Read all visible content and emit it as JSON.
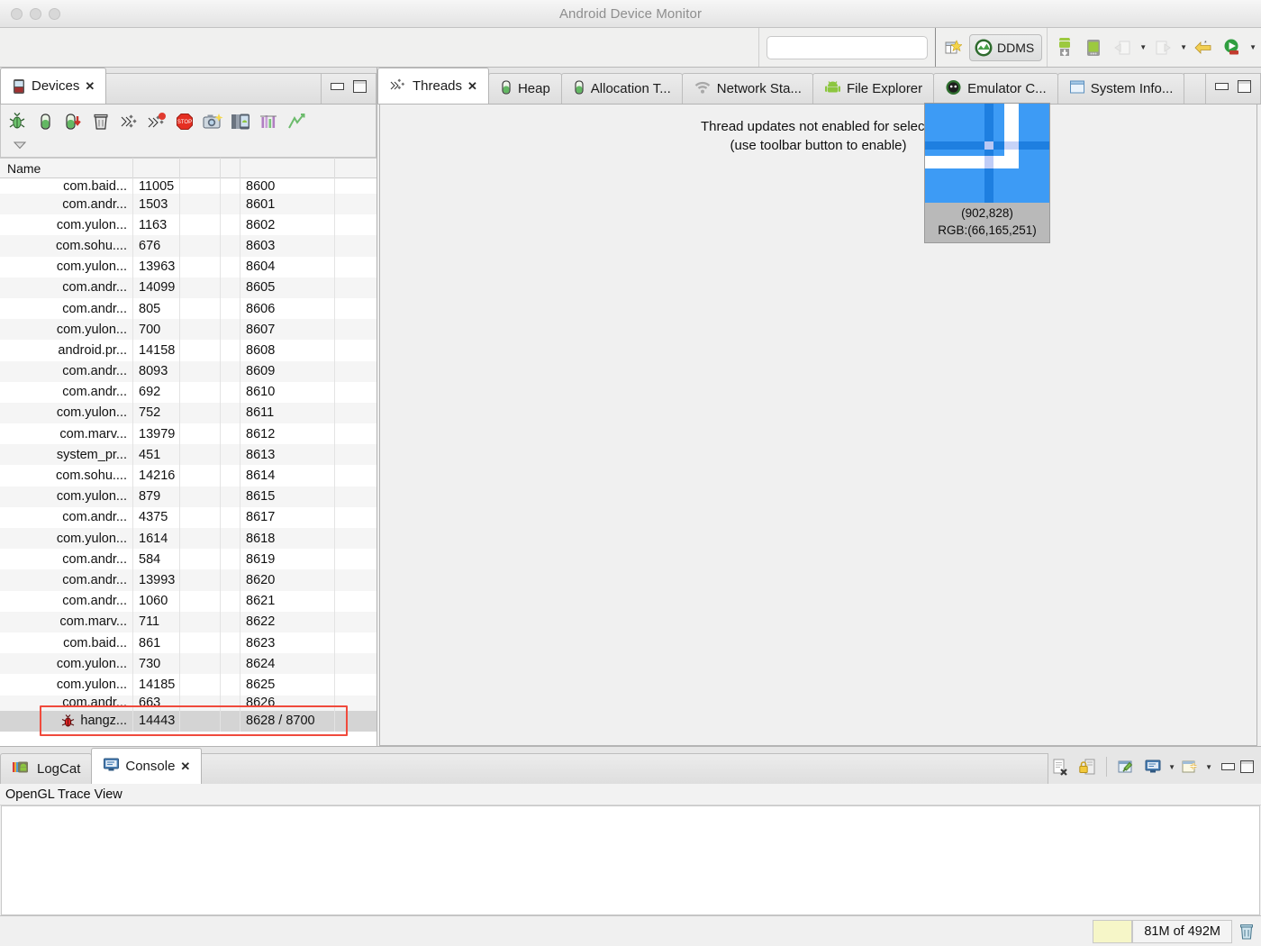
{
  "window": {
    "title": "Android Device Monitor",
    "traffic_lights": [
      "close",
      "minimize",
      "zoom"
    ]
  },
  "toolbar": {
    "search_value": "",
    "search_placeholder": "",
    "buttons": [
      {
        "name": "new-perspective-icon",
        "label": ""
      },
      {
        "name": "ddms-perspective-button",
        "label": "DDMS"
      },
      {
        "name": "device-download-icon",
        "label": ""
      },
      {
        "name": "device-screen-icon",
        "label": ""
      },
      {
        "name": "import-arrow-icon",
        "label": ""
      },
      {
        "name": "export-arrow-icon",
        "label": ""
      },
      {
        "name": "back-arrow-icon",
        "label": ""
      },
      {
        "name": "run-icon",
        "label": ""
      }
    ],
    "ddms_label": "DDMS"
  },
  "devices_panel": {
    "tab_label": "Devices",
    "tab_close": "✕",
    "toolbar_icons": [
      "debug-bug-icon",
      "heap-update-icon",
      "heap-dump-icon",
      "cause-gc-icon",
      "thread-update-icon",
      "thread-update-stop-icon",
      "stop-process-icon",
      "screen-capture-icon",
      "device-frame-icon",
      "systrace-icon",
      "method-profiling-icon",
      "overflow-menu-icon"
    ],
    "columns": [
      "Name",
      "",
      "",
      "",
      "",
      ""
    ],
    "rows": [
      {
        "name": "com.baid...",
        "pid": "11005",
        "port": "8600",
        "partial": true,
        "selected": false
      },
      {
        "name": "com.andr...",
        "pid": "1503",
        "port": "8601",
        "partial": false,
        "selected": false
      },
      {
        "name": "com.yulon...",
        "pid": "1163",
        "port": "8602",
        "partial": false,
        "selected": false
      },
      {
        "name": "com.sohu....",
        "pid": "676",
        "port": "8603",
        "partial": false,
        "selected": false
      },
      {
        "name": "com.yulon...",
        "pid": "13963",
        "port": "8604",
        "partial": false,
        "selected": false
      },
      {
        "name": "com.andr...",
        "pid": "14099",
        "port": "8605",
        "partial": false,
        "selected": false
      },
      {
        "name": "com.andr...",
        "pid": "805",
        "port": "8606",
        "partial": false,
        "selected": false
      },
      {
        "name": "com.yulon...",
        "pid": "700",
        "port": "8607",
        "partial": false,
        "selected": false
      },
      {
        "name": "android.pr...",
        "pid": "14158",
        "port": "8608",
        "partial": false,
        "selected": false
      },
      {
        "name": "com.andr...",
        "pid": "8093",
        "port": "8609",
        "partial": false,
        "selected": false
      },
      {
        "name": "com.andr...",
        "pid": "692",
        "port": "8610",
        "partial": false,
        "selected": false
      },
      {
        "name": "com.yulon...",
        "pid": "752",
        "port": "8611",
        "partial": false,
        "selected": false
      },
      {
        "name": "com.marv...",
        "pid": "13979",
        "port": "8612",
        "partial": false,
        "selected": false
      },
      {
        "name": "system_pr...",
        "pid": "451",
        "port": "8613",
        "partial": false,
        "selected": false
      },
      {
        "name": "com.sohu....",
        "pid": "14216",
        "port": "8614",
        "partial": false,
        "selected": false
      },
      {
        "name": "com.yulon...",
        "pid": "879",
        "port": "8615",
        "partial": false,
        "selected": false
      },
      {
        "name": "com.andr...",
        "pid": "4375",
        "port": "8617",
        "partial": false,
        "selected": false
      },
      {
        "name": "com.yulon...",
        "pid": "1614",
        "port": "8618",
        "partial": false,
        "selected": false
      },
      {
        "name": "com.andr...",
        "pid": "584",
        "port": "8619",
        "partial": false,
        "selected": false
      },
      {
        "name": "com.andr...",
        "pid": "13993",
        "port": "8620",
        "partial": false,
        "selected": false
      },
      {
        "name": "com.andr...",
        "pid": "1060",
        "port": "8621",
        "partial": false,
        "selected": false
      },
      {
        "name": "com.marv...",
        "pid": "711",
        "port": "8622",
        "partial": false,
        "selected": false
      },
      {
        "name": "com.baid...",
        "pid": "861",
        "port": "8623",
        "partial": false,
        "selected": false
      },
      {
        "name": "com.yulon...",
        "pid": "730",
        "port": "8624",
        "partial": false,
        "selected": false
      },
      {
        "name": "com.yulon...",
        "pid": "14185",
        "port": "8625",
        "partial": false,
        "selected": false
      },
      {
        "name": "com.andr...",
        "pid": "663",
        "port": "8626",
        "partial": true,
        "selected": false
      },
      {
        "name": "hangz...",
        "pid": "14443",
        "port": "8628 / 8700",
        "partial": false,
        "selected": true,
        "icon": "debug-bug-icon"
      }
    ],
    "panel_minimize": "minimize",
    "panel_maximize": "maximize"
  },
  "right_panel": {
    "tabs": [
      {
        "label": "Threads",
        "icon": "threads-icon",
        "active": true,
        "closable": true,
        "close": "✕"
      },
      {
        "label": "Heap",
        "icon": "heap-icon",
        "active": false,
        "closable": false
      },
      {
        "label": "Allocation T...",
        "icon": "allocation-icon",
        "active": false,
        "closable": false
      },
      {
        "label": "Network Sta...",
        "icon": "network-icon",
        "active": false,
        "closable": false
      },
      {
        "label": "File Explorer",
        "icon": "android-icon",
        "active": false,
        "closable": false
      },
      {
        "label": "Emulator C...",
        "icon": "emulator-icon",
        "active": false,
        "closable": false
      },
      {
        "label": "System Info...",
        "icon": "system-info-icon",
        "active": false,
        "closable": false
      }
    ],
    "panel_minimize": "minimize",
    "panel_maximize": "maximize",
    "threads_message_line1": "Thread updates not enabled for selecte",
    "threads_message_line2": "(use toolbar button to enable)"
  },
  "magnifier": {
    "coordinates": "(902,828)",
    "rgb": "RGB:(66,165,251)",
    "color_hex": "#42a5fb"
  },
  "bottom_panel": {
    "tabs": [
      {
        "label": "LogCat",
        "icon": "logcat-icon",
        "active": false,
        "closable": false
      },
      {
        "label": "Console",
        "icon": "console-icon",
        "active": true,
        "closable": true,
        "close": "✕"
      }
    ],
    "toolbar_icons": [
      "clear-console-icon",
      "lock-scroll-icon",
      "pin-console-icon",
      "display-selected-console-icon",
      "open-console-icon"
    ],
    "panel_minimize": "minimize",
    "panel_maximize": "maximize",
    "content_header": "OpenGL Trace View",
    "content_lines": []
  },
  "statusbar": {
    "memory": "81M of 492M",
    "trash_icon": "trash-icon"
  }
}
